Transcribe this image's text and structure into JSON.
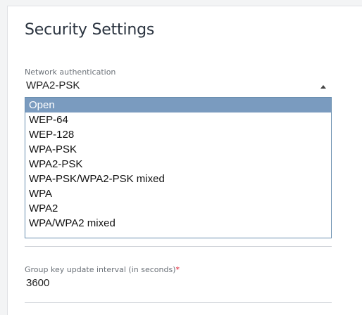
{
  "section": {
    "title": "Security Settings"
  },
  "auth": {
    "label": "Network authentication",
    "selected": "WPA2-PSK",
    "options": [
      "Open",
      "WEP-64",
      "WEP-128",
      "WPA-PSK",
      "WPA2-PSK",
      "WPA-PSK/WPA2-PSK mixed",
      "WPA",
      "WPA2",
      "WPA/WPA2 mixed"
    ],
    "highlighted_option": "Open"
  },
  "group_key": {
    "label": "Group key update interval (in seconds)",
    "required_mark": "*",
    "value": "3600"
  },
  "colors": {
    "highlight": "#7a9bbf",
    "required": "#e0182d",
    "dropdown_border": "#6a8fb0"
  },
  "icons": {
    "select_caret": "caret-up-icon"
  }
}
